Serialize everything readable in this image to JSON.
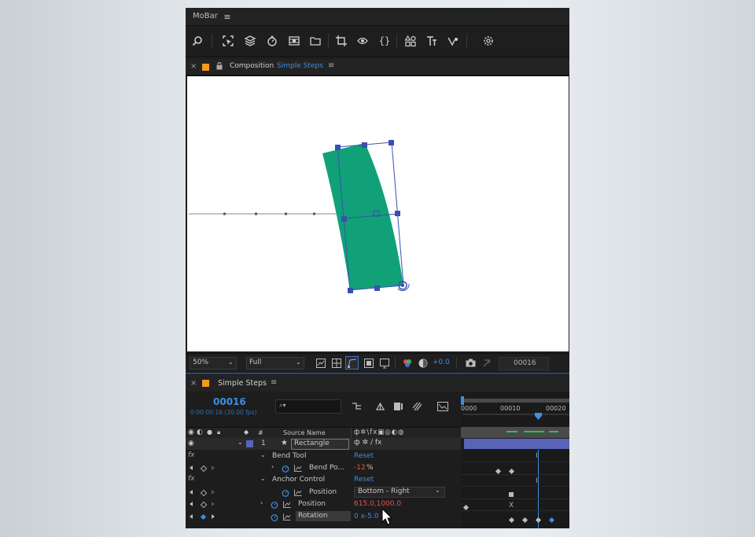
{
  "mobar": {
    "title": "MoBar",
    "menu_icon": "hamburger-icon",
    "tools": [
      "search-icon",
      "select-icon",
      "layers-icon",
      "stopwatch-icon",
      "film-icon",
      "folder-icon",
      "crop-icon",
      "eye-icon",
      "braces-icon",
      "shapes-icon",
      "text-icon",
      "graph-icon",
      "settings-icon"
    ]
  },
  "composition_panel": {
    "close": "×",
    "label": "Composition",
    "name": "Simple Steps",
    "menu_icon": "hamburger-icon",
    "accent_color": "#f29b1d",
    "link_color": "#2d8ceb"
  },
  "viewer": {
    "background": "#ffffff",
    "shape_color": "#11a178",
    "handle_color": "#3a4fb0"
  },
  "viewer_controls": {
    "zoom": "50%",
    "resolution": "Full",
    "exposure": "+0.0",
    "frame": "00016"
  },
  "timeline": {
    "close": "×",
    "comp_name": "Simple Steps",
    "timecode": "00016",
    "sub_timecode": "0:00:00:16 (30.00 fps)",
    "search_placeholder": "⌕▾",
    "ruler_ticks": [
      "0000",
      "00010",
      "00020"
    ],
    "columns": {
      "number": "#",
      "source_name": "Source Name"
    },
    "layer": {
      "number": "1",
      "name": "Rectangle",
      "color": "#5964b8"
    },
    "effects": [
      {
        "fx": "fx",
        "name": "Bend Tool",
        "reset": "Reset",
        "property": "Bend Po...",
        "value": "-12",
        "unit": "%"
      },
      {
        "fx": "fx",
        "name": "Anchor Control",
        "reset": "Reset"
      }
    ],
    "anchor_position": {
      "label": "Position",
      "value": "Bottom - Right"
    },
    "position": {
      "label": "Position",
      "value": "615.0,1000.0"
    },
    "rotation": {
      "label": "Rotation",
      "value": "0 x-5.0 °"
    }
  }
}
